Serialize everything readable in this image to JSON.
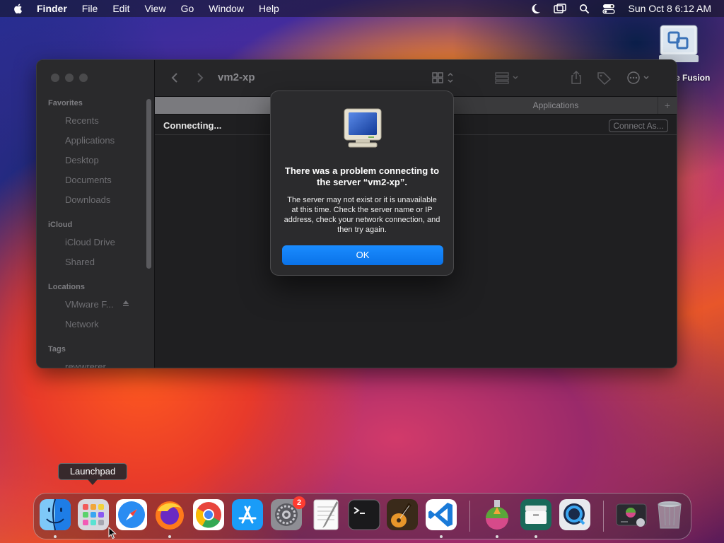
{
  "menubar": {
    "items": [
      "Finder",
      "File",
      "Edit",
      "View",
      "Go",
      "Window",
      "Help"
    ],
    "clock": "Sun Oct 8  6:12 AM"
  },
  "desktop": {
    "icon_label": "e Fusion"
  },
  "finder": {
    "title": "vm2-xp",
    "sidebar": {
      "favorites_header": "Favorites",
      "favorites": [
        "Recents",
        "Applications",
        "Desktop",
        "Documents",
        "Downloads"
      ],
      "icloud_header": "iCloud",
      "icloud": [
        "iCloud Drive",
        "Shared"
      ],
      "locations_header": "Locations",
      "locations": [
        "VMware F...",
        "Network"
      ],
      "tags_header": "Tags",
      "tags": [
        "rewwrerer"
      ]
    },
    "tab_right": "Applications",
    "tab_plus": "+",
    "status": "Connecting...",
    "connect_as": "Connect As..."
  },
  "dialog": {
    "title": "There was a problem connecting to the server “vm2-xp”.",
    "body": "The server may not exist or it is unavailable at this time. Check the server name or IP address, check your network connection, and then try again.",
    "ok_label": "OK"
  },
  "dock": {
    "tooltip": "Launchpad",
    "settings_badge": "2"
  },
  "colors": {
    "accent": "#0a7cff",
    "badge": "#ff3b30"
  }
}
